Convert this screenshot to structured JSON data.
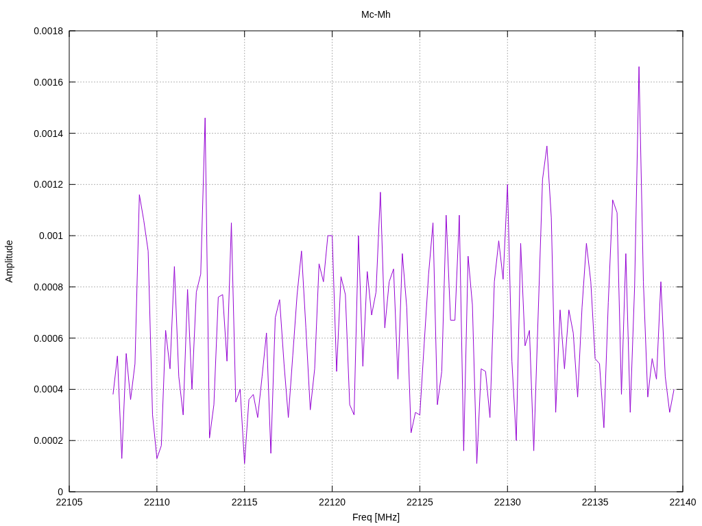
{
  "chart_data": {
    "type": "line",
    "grid": true,
    "title": "Mc-Mh",
    "xlabel": "Freq [MHz]",
    "ylabel": "Amplitude",
    "xlim": [
      22105,
      22140
    ],
    "ylim": [
      0,
      0.0018
    ],
    "xticks": [
      22105,
      22110,
      22115,
      22120,
      22125,
      22130,
      22135,
      22140
    ],
    "yticks": [
      0,
      0.0002,
      0.0004,
      0.0006,
      0.0008,
      0.001,
      0.0012,
      0.0014,
      0.0016,
      0.0018
    ],
    "x": [
      22107.5,
      22107.75,
      22108,
      22108.25,
      22108.5,
      22108.75,
      22109,
      22109.25,
      22109.5,
      22109.75,
      22110,
      22110.25,
      22110.5,
      22110.75,
      22111,
      22111.25,
      22111.5,
      22111.75,
      22112,
      22112.25,
      22112.5,
      22112.75,
      22113,
      22113.25,
      22113.5,
      22113.75,
      22114,
      22114.25,
      22114.5,
      22114.75,
      22115,
      22115.25,
      22115.5,
      22115.75,
      22116,
      22116.25,
      22116.5,
      22116.75,
      22117,
      22117.25,
      22117.5,
      22117.75,
      22118,
      22118.25,
      22118.5,
      22118.75,
      22119,
      22119.25,
      22119.5,
      22119.75,
      22120,
      22120.25,
      22120.5,
      22120.75,
      22121,
      22121.25,
      22121.5,
      22121.75,
      22122,
      22122.25,
      22122.5,
      22122.75,
      22123,
      22123.25,
      22123.5,
      22123.75,
      22124,
      22124.25,
      22124.5,
      22124.75,
      22125,
      22125.25,
      22125.5,
      22125.75,
      22126,
      22126.25,
      22126.5,
      22126.75,
      22127,
      22127.25,
      22127.5,
      22127.75,
      22128,
      22128.25,
      22128.5,
      22128.75,
      22129,
      22129.25,
      22129.5,
      22129.75,
      22130,
      22130.25,
      22130.5,
      22130.75,
      22131,
      22131.25,
      22131.5,
      22131.75,
      22132,
      22132.25,
      22132.5,
      22132.75,
      22133,
      22133.25,
      22133.5,
      22133.75,
      22134,
      22134.25,
      22134.5,
      22134.75,
      22135,
      22135.25,
      22135.5,
      22135.75,
      22136,
      22136.25,
      22136.5,
      22136.75,
      22137,
      22137.25,
      22137.5,
      22137.75,
      22138,
      22138.25,
      22138.5,
      22138.75,
      22139,
      22139.25,
      22139.5
    ],
    "series": [
      {
        "color": "#9400d3",
        "values": [
          0.00038,
          0.00053,
          0.00013,
          0.00054,
          0.00036,
          0.0005,
          0.00116,
          0.00106,
          0.00094,
          0.0003,
          0.00013,
          0.00018,
          0.00063,
          0.00048,
          0.00088,
          0.00045,
          0.0003,
          0.00079,
          0.0004,
          0.00078,
          0.00085,
          0.00146,
          0.00021,
          0.00034,
          0.00076,
          0.00077,
          0.00051,
          0.00105,
          0.00035,
          0.0004,
          0.00011,
          0.00036,
          0.00038,
          0.00029,
          0.00045,
          0.00062,
          0.00015,
          0.00068,
          0.00075,
          0.0005,
          0.00029,
          0.00053,
          0.00077,
          0.00094,
          0.00064,
          0.00032,
          0.00048,
          0.00089,
          0.00082,
          0.001,
          0.001,
          0.00047,
          0.00084,
          0.00077,
          0.00034,
          0.0003,
          0.001,
          0.00049,
          0.00086,
          0.00069,
          0.00078,
          0.00117,
          0.00064,
          0.00082,
          0.00087,
          0.00044,
          0.00093,
          0.00072,
          0.00023,
          0.00031,
          0.0003,
          0.00058,
          0.00085,
          0.00105,
          0.00034,
          0.00047,
          0.00108,
          0.00067,
          0.00067,
          0.00108,
          0.00016,
          0.00092,
          0.00073,
          0.00011,
          0.00048,
          0.00047,
          0.00029,
          0.00082,
          0.00098,
          0.00083,
          0.0012,
          0.00051,
          0.0002,
          0.00097,
          0.00057,
          0.00063,
          0.00016,
          0.00069,
          0.00122,
          0.00135,
          0.00107,
          0.00031,
          0.00071,
          0.00048,
          0.00071,
          0.00062,
          0.00037,
          0.00072,
          0.00097,
          0.00082,
          0.00052,
          0.0005,
          0.00025,
          0.00074,
          0.00114,
          0.00109,
          0.00038,
          0.00093,
          0.00031,
          0.0008,
          0.00166,
          0.00082,
          0.00037,
          0.00052,
          0.00044,
          0.00082,
          0.00045,
          0.00031,
          0.0004
        ]
      }
    ]
  }
}
